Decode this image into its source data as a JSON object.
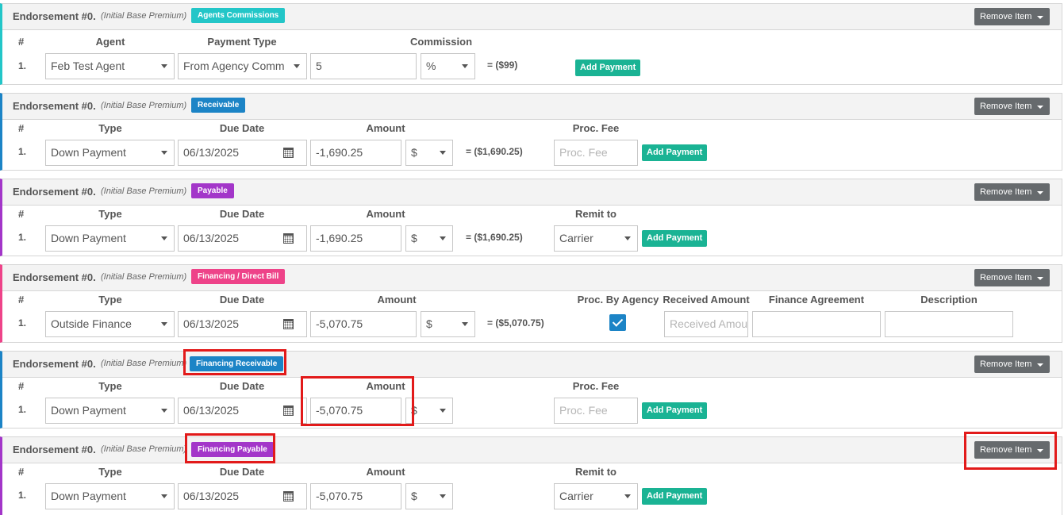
{
  "colors": {
    "teal": "#23c6c8",
    "blue": "#1c84c6",
    "purple": "#a336c9",
    "pink": "#ee4389",
    "green_button": "#1ab394",
    "highlight_red": "#e21a1a"
  },
  "common": {
    "endorsement_title": "Endorsement #0.",
    "endorsement_subtitle": "(Initial Base Premium)",
    "remove_item": "Remove Item",
    "add_payment": "Add Payment",
    "row_number": "1.",
    "hash": "#"
  },
  "sections": [
    {
      "badge": "Agents Commissions",
      "headers": {
        "col1": "Agent",
        "col2": "Payment Type",
        "col3": "Commission"
      },
      "fields": {
        "agent": "Feb Test Agent",
        "payment_type": "From Agency Comm",
        "commission_value": "5",
        "unit": "%"
      },
      "equals": "= ($99)"
    },
    {
      "badge": "Receivable",
      "headers": {
        "type": "Type",
        "due_date": "Due Date",
        "amount": "Amount",
        "extra": "Proc. Fee"
      },
      "fields": {
        "type": "Down Payment",
        "due_date": "06/13/2025",
        "amount": "-1,690.25",
        "unit": "$",
        "extra_placeholder": "Proc. Fee"
      },
      "equals": "= ($1,690.25)"
    },
    {
      "badge": "Payable",
      "headers": {
        "type": "Type",
        "due_date": "Due Date",
        "amount": "Amount",
        "extra": "Remit to"
      },
      "fields": {
        "type": "Down Payment",
        "due_date": "06/13/2025",
        "amount": "-1,690.25",
        "unit": "$",
        "remit_to": "Carrier"
      },
      "equals": "= ($1,690.25)"
    },
    {
      "badge": "Financing / Direct Bill",
      "headers": {
        "type": "Type",
        "due_date": "Due Date",
        "amount": "Amount",
        "proc_by_agency": "Proc. By Agency",
        "received_amount": "Received Amount",
        "finance_agreement": "Finance Agreement",
        "description": "Description"
      },
      "fields": {
        "type": "Outside Finance",
        "due_date": "06/13/2025",
        "amount": "-5,070.75",
        "unit": "$",
        "received_placeholder": "Received Amount",
        "proc_by_agency_checked": true
      },
      "equals": "= ($5,070.75)"
    },
    {
      "badge": "Financing Receivable",
      "headers": {
        "type": "Type",
        "due_date": "Due Date",
        "amount": "Amount",
        "extra": "Proc. Fee"
      },
      "fields": {
        "type": "Down Payment",
        "due_date": "06/13/2025",
        "amount": "-5,070.75",
        "unit": "$",
        "extra_placeholder": "Proc. Fee"
      }
    },
    {
      "badge": "Financing Payable",
      "headers": {
        "type": "Type",
        "due_date": "Due Date",
        "amount": "Amount",
        "extra": "Remit to"
      },
      "fields": {
        "type": "Down Payment",
        "due_date": "06/13/2025",
        "amount": "-5,070.75",
        "unit": "$",
        "remit_to": "Carrier"
      }
    }
  ]
}
